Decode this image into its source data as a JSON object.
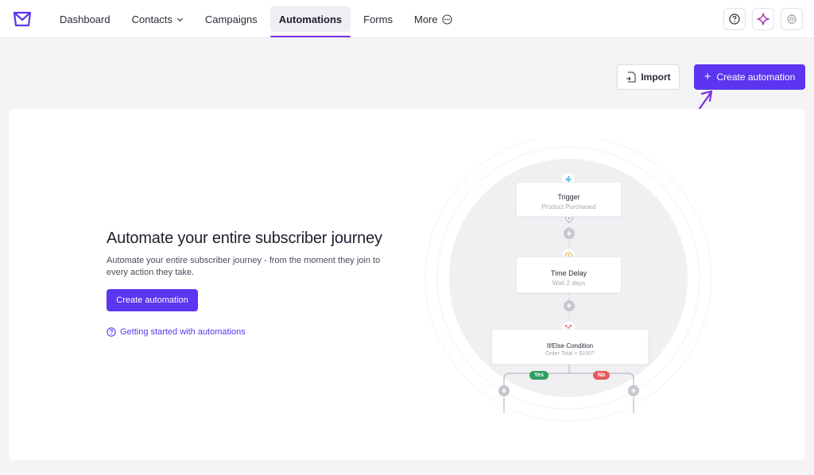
{
  "nav": {
    "items": [
      {
        "label": "Dashboard"
      },
      {
        "label": "Contacts"
      },
      {
        "label": "Campaigns"
      },
      {
        "label": "Automations"
      },
      {
        "label": "Forms"
      },
      {
        "label": "More"
      }
    ],
    "active": "Automations"
  },
  "toolbar": {
    "import_label": "Import",
    "create_label": "Create automation"
  },
  "hero": {
    "title": "Automate your entire subscriber journey",
    "description": "Automate your entire subscriber journey - from the moment they join to every action they take.",
    "create_label": "Create automation",
    "help_link": "Getting started with automations"
  },
  "workflow": {
    "trigger": {
      "title": "Trigger",
      "subtitle": "Product Purchased"
    },
    "delay": {
      "title": "Time Delay",
      "subtitle": "Wait 2 days"
    },
    "condition": {
      "title": "If/Else Condition",
      "subtitle": "Order Total > $100?"
    },
    "yes_label": "Yes",
    "no_label": "No"
  },
  "colors": {
    "accent": "#5b35f0",
    "nav_underline": "#7a2fe0",
    "yes": "#2f9e62",
    "no": "#e85c5c"
  },
  "icons": [
    "mail-logo-icon",
    "chevron-down-icon",
    "more-circle-icon",
    "help-icon",
    "sparkle-icon",
    "gear-icon",
    "import-file-icon",
    "plus-icon",
    "lightning-icon",
    "clock-icon",
    "split-icon"
  ]
}
